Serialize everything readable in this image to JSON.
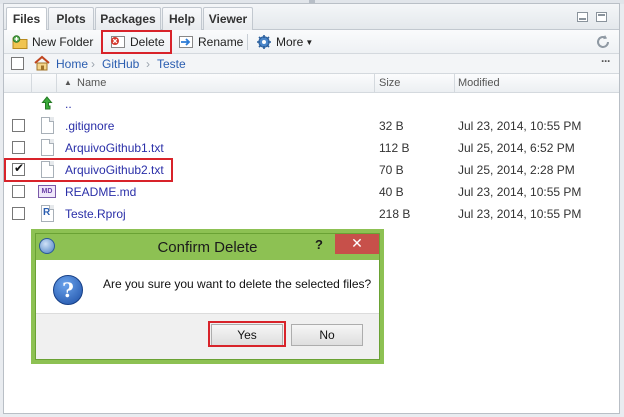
{
  "tabs": [
    {
      "label": "Files",
      "active": true
    },
    {
      "label": "Plots"
    },
    {
      "label": "Packages"
    },
    {
      "label": "Help"
    },
    {
      "label": "Viewer"
    }
  ],
  "toolbar": {
    "new_folder": "New Folder",
    "delete": "Delete",
    "rename": "Rename",
    "more": "More"
  },
  "breadcrumb": [
    "Home",
    "GitHub",
    "Teste"
  ],
  "columns": {
    "name": "Name",
    "size": "Size",
    "modified": "Modified"
  },
  "parent_dir": "..",
  "files": [
    {
      "name": ".gitignore",
      "size": "32 B",
      "modified": "Jul 23, 2014, 10:55 PM",
      "checked": false,
      "icon": "text-file-icon"
    },
    {
      "name": "ArquivoGithub1.txt",
      "size": "112 B",
      "modified": "Jul 25, 2014, 6:52 PM",
      "checked": false,
      "icon": "text-file-icon"
    },
    {
      "name": "ArquivoGithub2.txt",
      "size": "70 B",
      "modified": "Jul 25, 2014, 2:28 PM",
      "checked": true,
      "icon": "text-file-icon"
    },
    {
      "name": "README.md",
      "size": "40 B",
      "modified": "Jul 23, 2014, 10:55 PM",
      "checked": false,
      "icon": "markdown-file-icon"
    },
    {
      "name": "Teste.Rproj",
      "size": "218 B",
      "modified": "Jul 23, 2014, 10:55 PM",
      "checked": false,
      "icon": "rproj-file-icon"
    }
  ],
  "dialog": {
    "title": "Confirm Delete",
    "help": "?",
    "close": "✕",
    "message": "Are you sure you want to delete the selected files?",
    "yes": "Yes",
    "no": "No"
  },
  "colors": {
    "highlight": "#d8232a",
    "dialog_frame": "#8dc153",
    "link": "#2a2fa8"
  }
}
